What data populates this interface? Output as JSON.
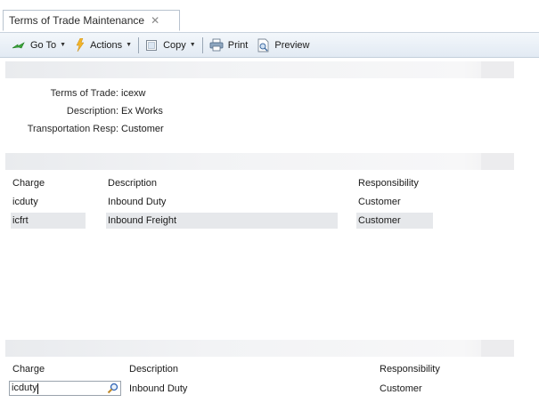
{
  "tab": {
    "title": "Terms of Trade Maintenance",
    "close_glyph": "✕"
  },
  "toolbar": {
    "goto_label": "Go To",
    "actions_label": "Actions",
    "copy_label": "Copy",
    "print_label": "Print",
    "preview_label": "Preview",
    "icons": [
      "goto-arrow-icon",
      "actions-lightning-icon",
      "copy-icon",
      "print-icon",
      "preview-icon"
    ]
  },
  "header": {
    "fields": [
      {
        "label": "Terms of Trade:",
        "value": "icexw"
      },
      {
        "label": "Description:",
        "value": "Ex Works"
      },
      {
        "label": "Transportation Resp:",
        "value": "Customer"
      }
    ]
  },
  "grid": {
    "columns": [
      "Charge",
      "Description",
      "Responsibility"
    ],
    "rows": [
      {
        "charge": "icduty",
        "description": "Inbound Duty",
        "responsibility": "Customer"
      },
      {
        "charge": "icfrt",
        "description": "Inbound Freight",
        "responsibility": "Customer"
      }
    ]
  },
  "editor": {
    "columns": [
      "Charge",
      "Description",
      "Responsibility"
    ],
    "charge_value": "icduty",
    "description": "Inbound Duty",
    "responsibility": "Customer"
  },
  "colors": {
    "toolbar_top": "#f3f7fb",
    "toolbar_bottom": "#e2eaf3",
    "selected_row": "#e6e8eb",
    "section_bar": "#eeeff1"
  }
}
